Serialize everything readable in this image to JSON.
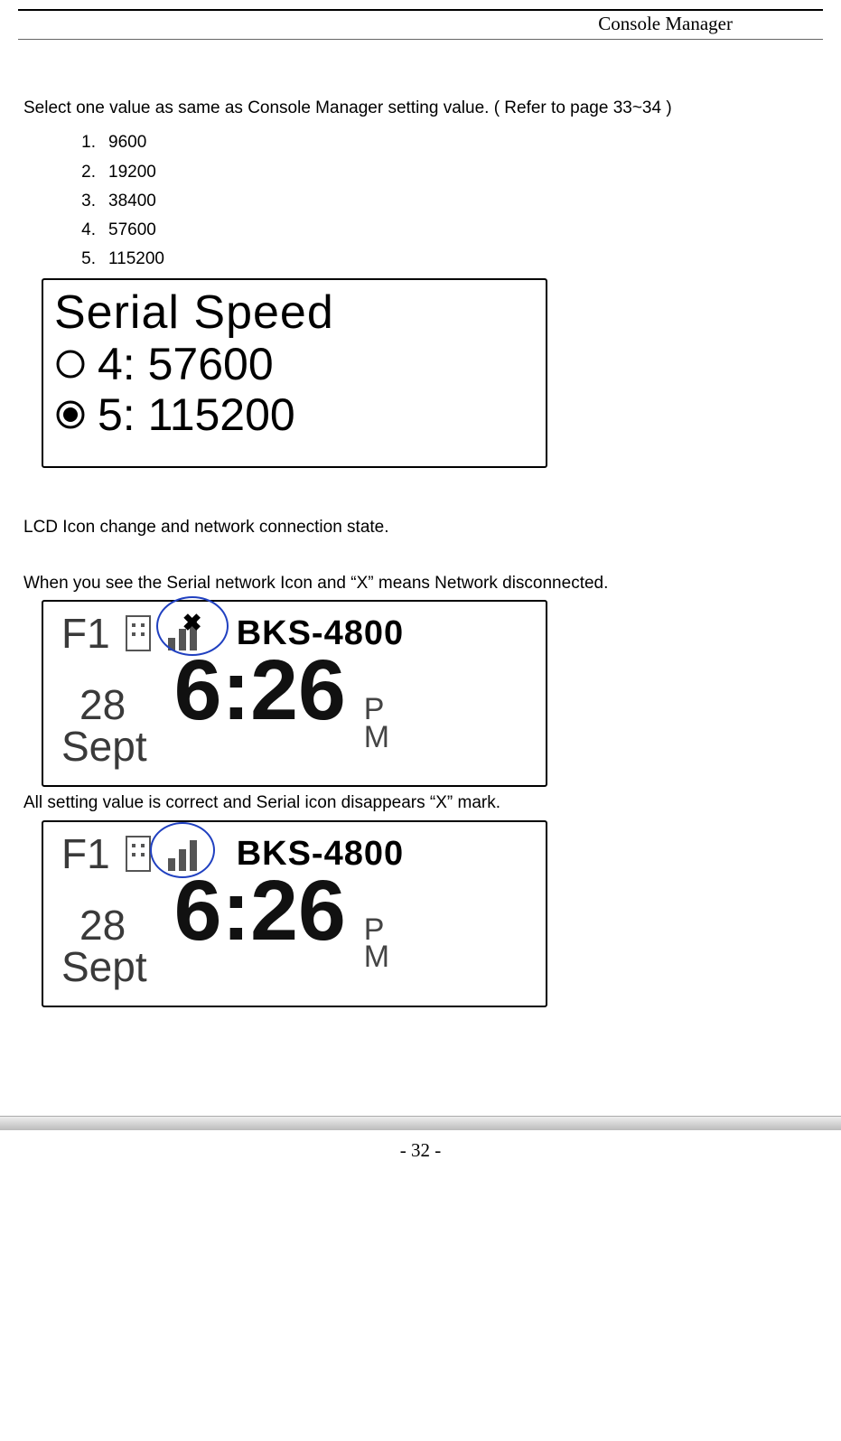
{
  "header": {
    "title": "Console Manager"
  },
  "intro": "Select one value as same as Console Manager setting value. ( Refer to page 33~34 )",
  "speed_options": {
    "items": [
      {
        "n": "1.",
        "v": "9600"
      },
      {
        "n": "2.",
        "v": "19200"
      },
      {
        "n": "3.",
        "v": "38400"
      },
      {
        "n": "4.",
        "v": "57600"
      },
      {
        "n": "5.",
        "v": "115200"
      }
    ]
  },
  "serial_box": {
    "title": "Serial Speed",
    "optA": "4: 57600",
    "optB": "5: 115200"
  },
  "text_after_box": "LCD Icon change and network connection state.",
  "lcd_disc_text": "When you see the Serial network Icon and “X” means Network disconnected.",
  "lcd": {
    "f1": "F1",
    "model": "BKS-4800",
    "day": "28",
    "month": "Sept",
    "time": "6:26",
    "pm_p": "P",
    "pm_m": "M",
    "x_mark": "✖"
  },
  "lcd_ok_text": "All setting value is correct and Serial icon disappears “X” mark.",
  "footer": {
    "page": "- 32 -"
  }
}
